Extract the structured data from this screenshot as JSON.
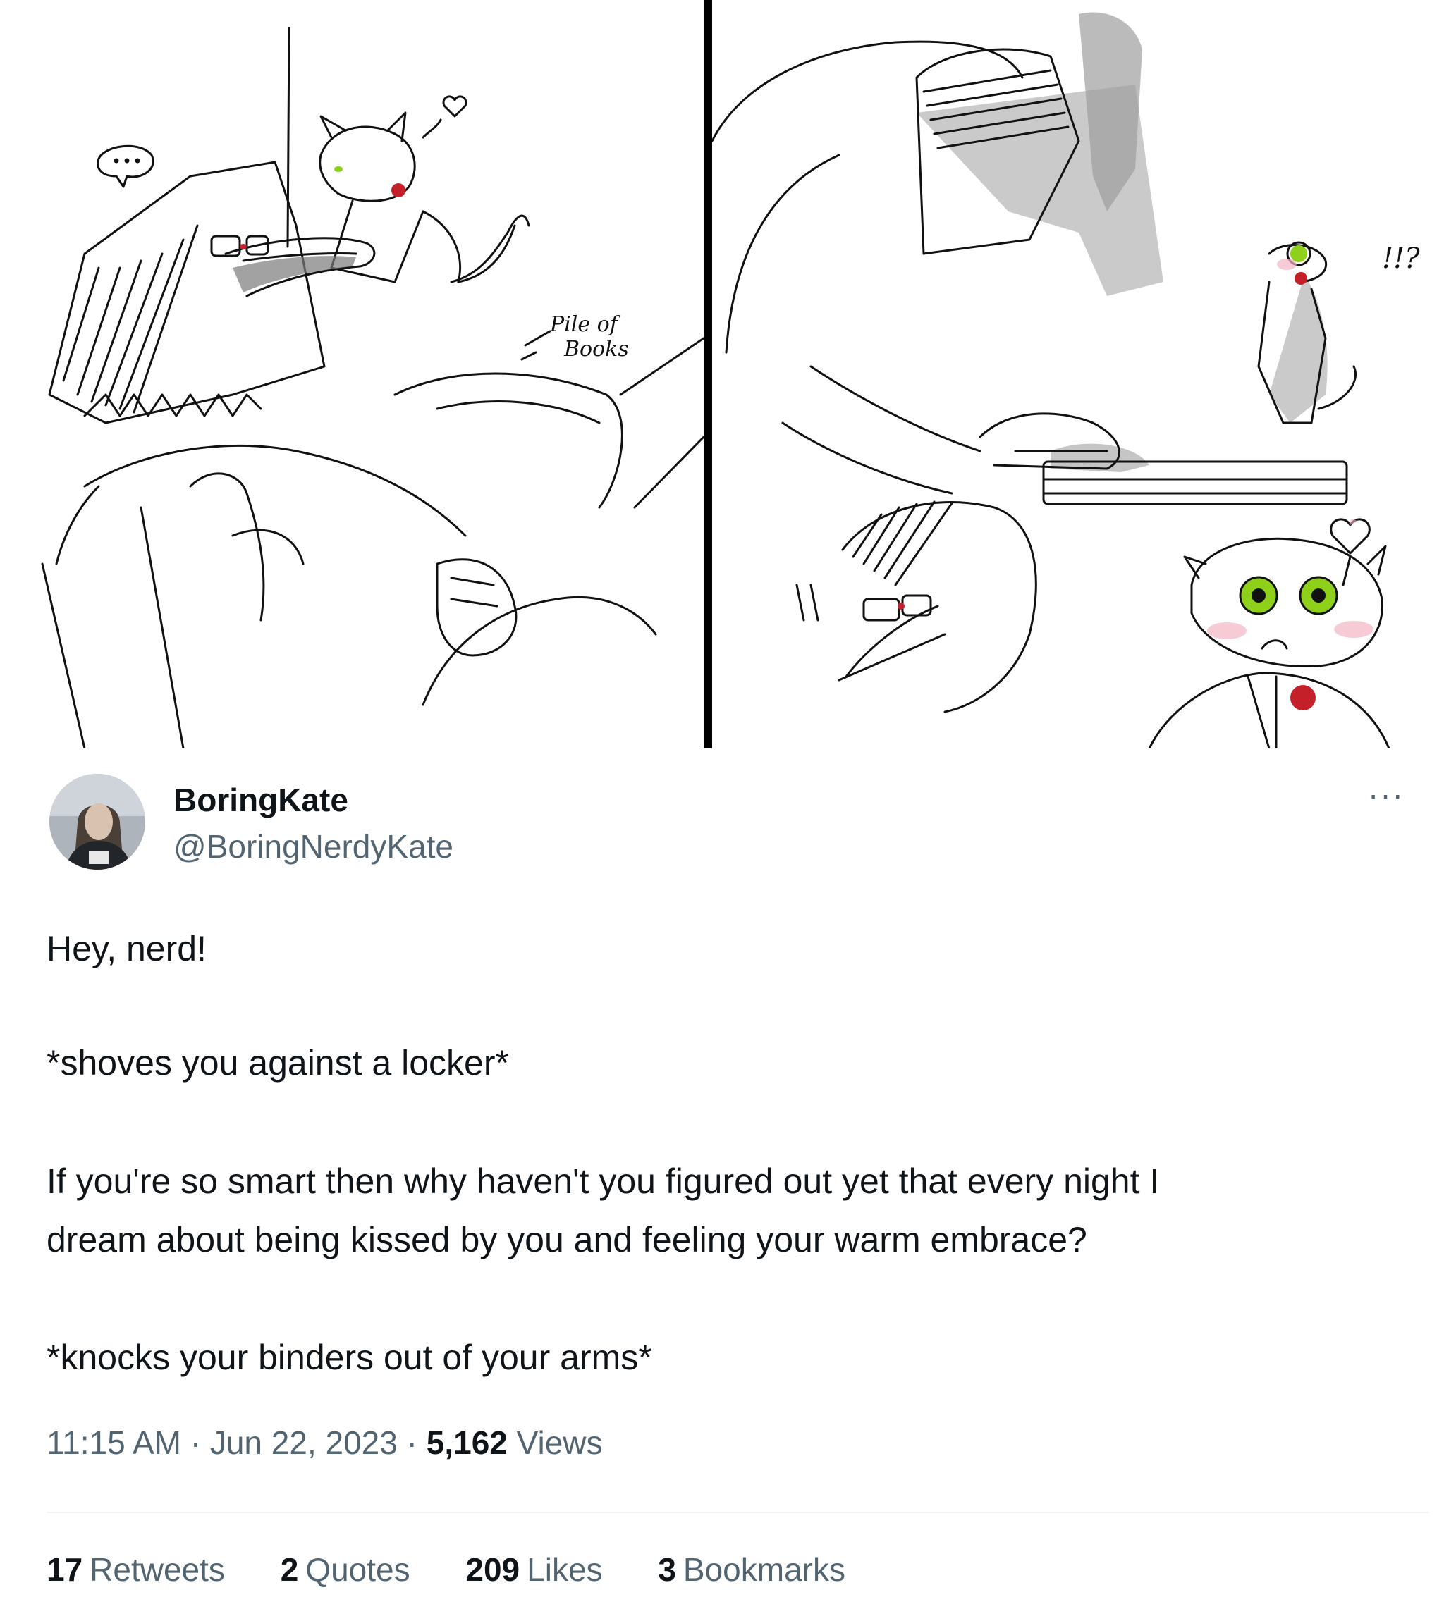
{
  "comic": {
    "left_panel_label_1": "Pile of",
    "left_panel_label_2": "Books",
    "right_panel_exclaim": "!!?"
  },
  "tweet": {
    "display_name": "BoringKate",
    "handle": "@BoringNerdyKate",
    "more_label": "···",
    "lines": [
      "Hey, nerd!",
      "*shoves you against a locker*",
      "If you're so smart then why haven't you figured out yet that every night I",
      "dream about being kissed by you and feeling your warm embrace?",
      "*knocks your binders out of your arms*"
    ],
    "time": "11:15 AM",
    "date": "Jun 22, 2023",
    "views_count": "5,162",
    "views_label": "Views",
    "separator": "·",
    "stats": [
      {
        "count": "17",
        "label": "Retweets"
      },
      {
        "count": "2",
        "label": "Quotes"
      },
      {
        "count": "209",
        "label": "Likes"
      },
      {
        "count": "3",
        "label": "Bookmarks"
      }
    ]
  },
  "colors": {
    "text_primary": "#0f1419",
    "text_secondary": "#536471",
    "rule": "#eff3f4",
    "accent_rose": "#c4202a",
    "accent_eye": "#8fd11a"
  }
}
